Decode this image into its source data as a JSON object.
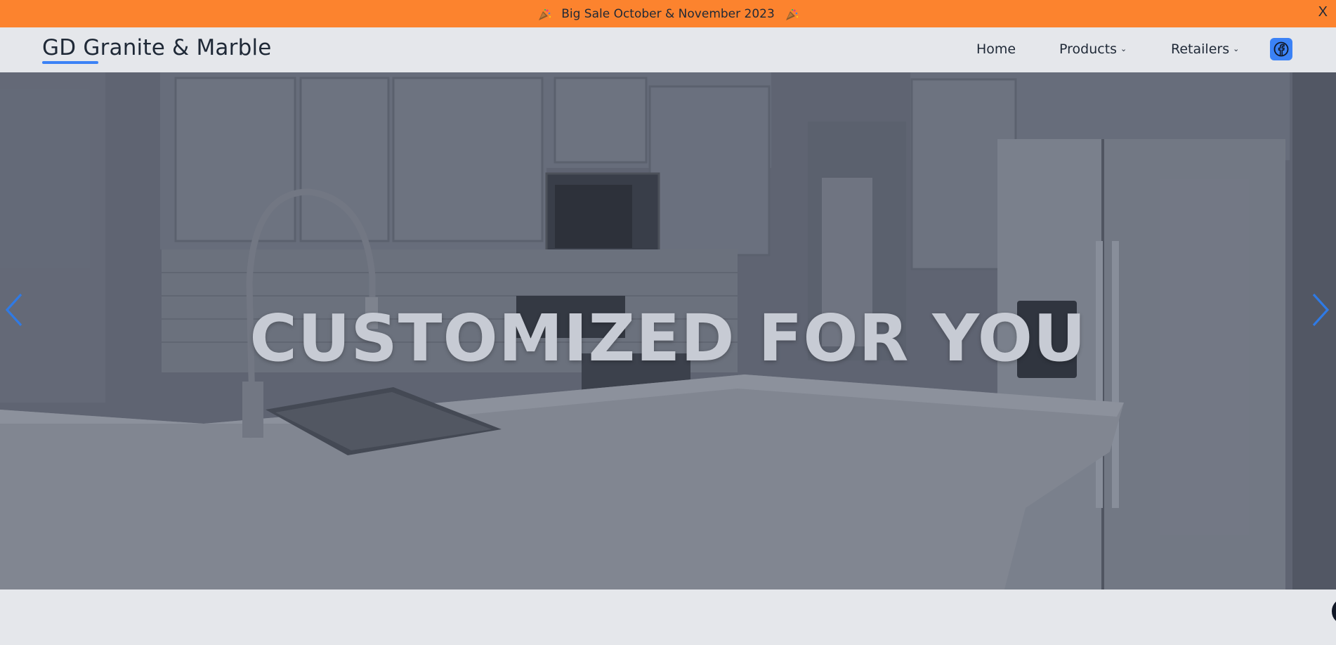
{
  "announcement": {
    "text": "Big Sale October & November 2023",
    "close_label": "X",
    "left_icon": "party-popper-icon",
    "right_icon": "party-popper-icon",
    "background": "#fc832e"
  },
  "header": {
    "logo": "GD Granite & Marble",
    "accent": "#3b82f6",
    "nav": [
      {
        "label": "Home",
        "has_dropdown": false
      },
      {
        "label": "Products",
        "has_dropdown": true
      },
      {
        "label": "Retailers",
        "has_dropdown": true
      }
    ],
    "social_icon": "facebook-icon"
  },
  "hero": {
    "title": "CUSTOMIZED FOR YOU",
    "prev_icon": "chevron-left-icon",
    "next_icon": "chevron-right-icon"
  }
}
